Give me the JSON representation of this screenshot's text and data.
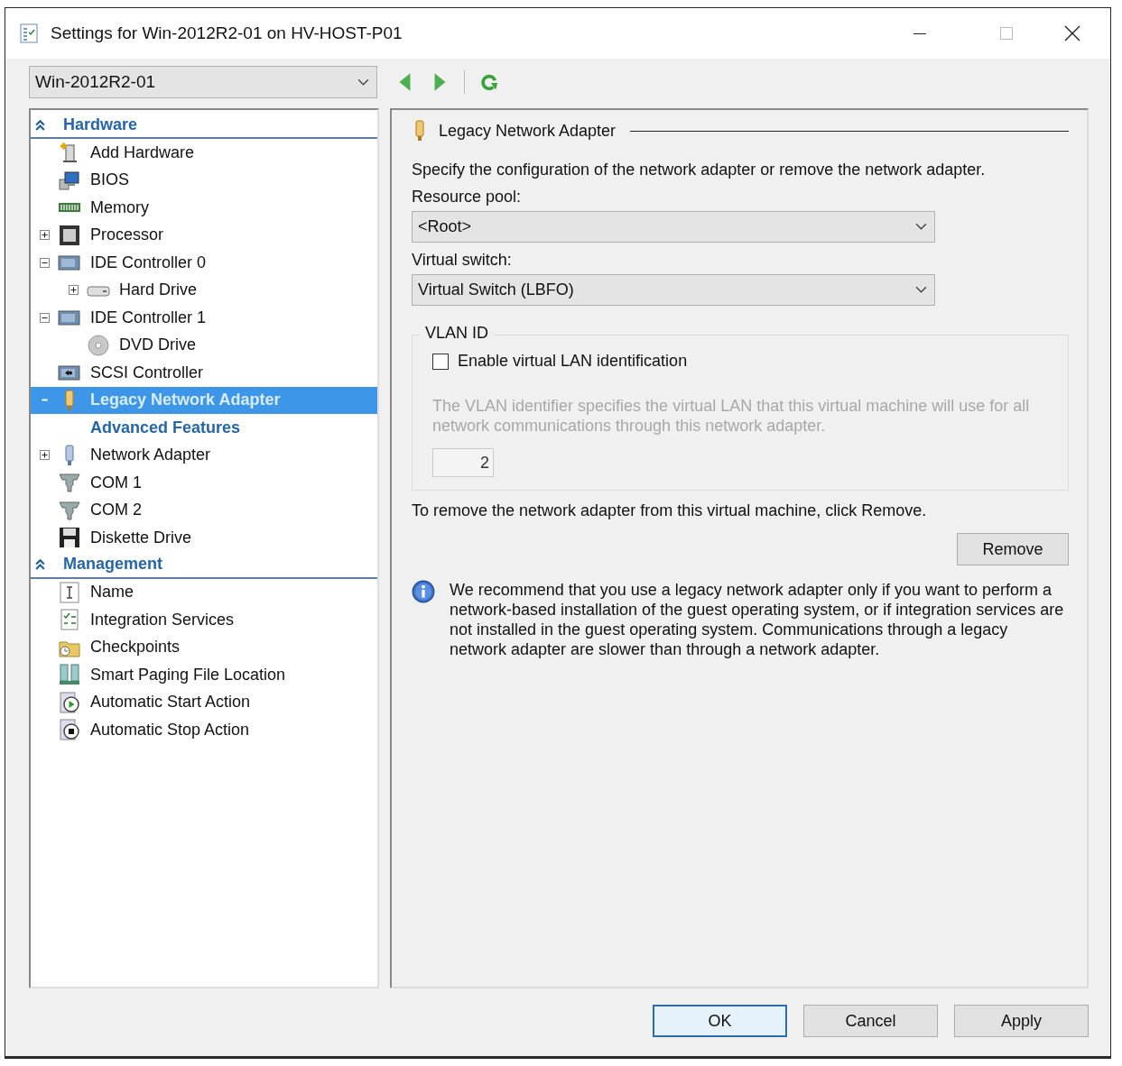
{
  "window": {
    "title": "Settings for Win-2012R2-01 on HV-HOST-P01"
  },
  "vm_selector": {
    "value": "Win-2012R2-01"
  },
  "tree": {
    "sections": [
      {
        "label": "Hardware",
        "expanded": true,
        "items": [
          {
            "label": "Add Hardware",
            "kind": "add-hardware",
            "selected": false
          },
          {
            "label": "BIOS",
            "kind": "bios",
            "selected": false
          },
          {
            "label": "Memory",
            "kind": "memory",
            "selected": false
          },
          {
            "label": "Processor",
            "kind": "processor",
            "selected": false,
            "expanded": false
          },
          {
            "label": "IDE Controller 0",
            "kind": "controller",
            "selected": false,
            "expanded": true,
            "children": [
              {
                "label": "Hard Drive",
                "kind": "hard-drive",
                "selected": false,
                "expanded": false
              }
            ]
          },
          {
            "label": "IDE Controller 1",
            "kind": "controller",
            "selected": false,
            "expanded": true,
            "children": [
              {
                "label": "DVD Drive",
                "kind": "dvd",
                "selected": false
              }
            ]
          },
          {
            "label": "SCSI Controller",
            "kind": "scsi",
            "selected": false
          },
          {
            "label": "Legacy Network Adapter",
            "kind": "network",
            "selected": true,
            "expanded": true,
            "children": [
              {
                "label": "Advanced Features",
                "kind": "subpage",
                "selected": false
              }
            ]
          },
          {
            "label": "Network Adapter",
            "kind": "network",
            "selected": false,
            "expanded": false
          },
          {
            "label": "COM 1",
            "kind": "com",
            "selected": false
          },
          {
            "label": "COM 2",
            "kind": "com",
            "selected": false
          },
          {
            "label": "Diskette Drive",
            "kind": "floppy",
            "selected": false
          }
        ]
      },
      {
        "label": "Management",
        "expanded": true,
        "items": [
          {
            "label": "Name",
            "kind": "name",
            "selected": false
          },
          {
            "label": "Integration Services",
            "kind": "checklist",
            "selected": false
          },
          {
            "label": "Checkpoints",
            "kind": "checkpoint",
            "selected": false
          },
          {
            "label": "Smart Paging File Location",
            "kind": "paging",
            "selected": false
          },
          {
            "label": "Automatic Start Action",
            "kind": "start",
            "selected": false
          },
          {
            "label": "Automatic Stop Action",
            "kind": "stop",
            "selected": false
          }
        ]
      }
    ]
  },
  "details": {
    "title": "Legacy Network Adapter",
    "description": "Specify the configuration of the network adapter or remove the network adapter.",
    "fields": [
      {
        "label": "Resource pool:",
        "value": "<Root>"
      },
      {
        "label": "Virtual switch:",
        "value": "Virtual Switch (LBFO)"
      }
    ],
    "vlan": {
      "legend": "VLAN ID",
      "checkbox": {
        "label": "Enable virtual LAN identification",
        "checked": false
      },
      "help": "The VLAN identifier specifies the virtual LAN that this virtual machine will use for all network communications through this network adapter.",
      "value": "2",
      "disabled": true
    },
    "remove_text": "To remove the network adapter from this virtual machine, click Remove.",
    "remove_button": "Remove",
    "note": "We recommend that you use a legacy network adapter only if you want to perform a network-based installation of the guest operating system, or if integration services are not installed in the guest operating system. Communications through a legacy network adapter are slower than through a network adapter."
  },
  "buttons": [
    {
      "label": "OK",
      "default": true
    },
    {
      "label": "Cancel",
      "default": false
    },
    {
      "label": "Apply",
      "default": false
    }
  ]
}
